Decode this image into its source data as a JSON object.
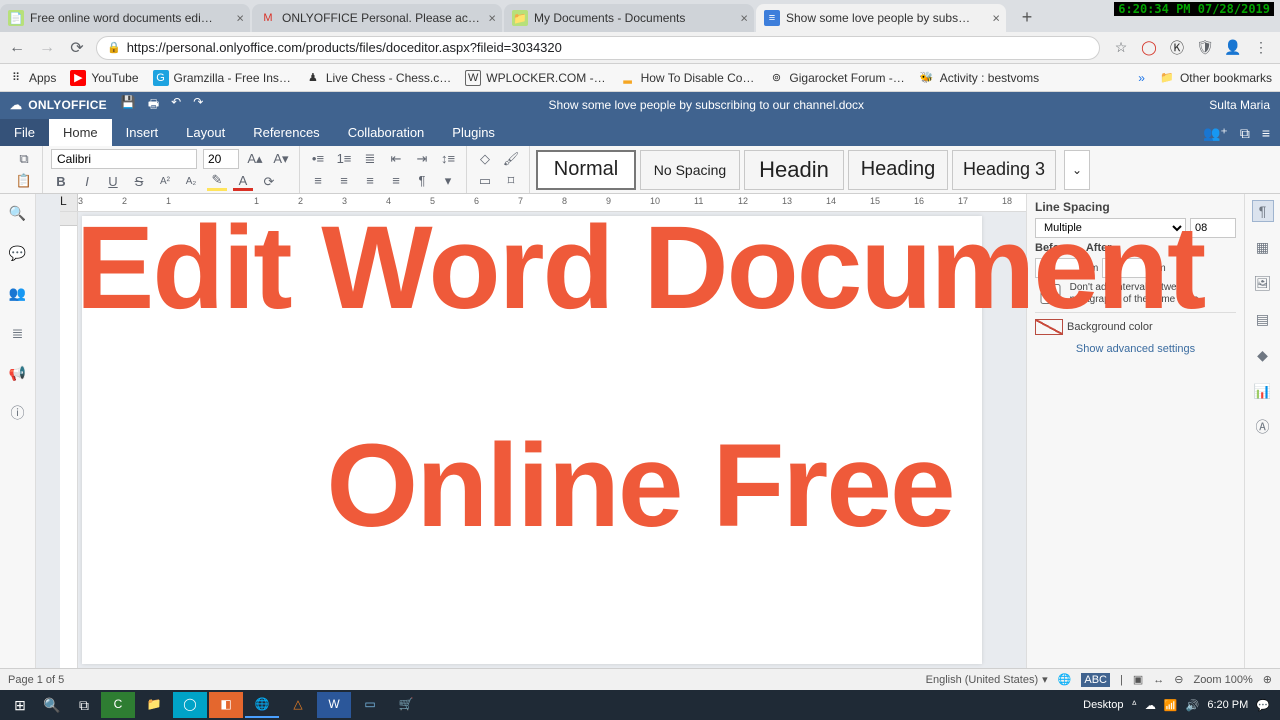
{
  "chrome": {
    "tabs": [
      {
        "title": "Free online word documents edi…"
      },
      {
        "title": "ONLYOFFICE Personal. Please ac…"
      },
      {
        "title": "My Documents - Documents"
      },
      {
        "title": "Show some love people by subs…"
      }
    ],
    "active_tab": 3,
    "url": "https://personal.onlyoffice.com/products/files/doceditor.aspx?fileid=3034320",
    "timestamp": "6:20:34 PM 07/28/2019",
    "bookmarks": [
      "Apps",
      "YouTube",
      "Gramzilla - Free Ins…",
      "Live Chess - Chess.c…",
      "WPLOCKER.COM -…",
      "How To Disable Co…",
      "Gigarocket Forum -…",
      "Activity : bestvoms"
    ],
    "other_bookmarks": "Other bookmarks"
  },
  "oo": {
    "brand": "ONLYOFFICE",
    "doc_title": "Show some love people by subscribing to our channel.docx",
    "user": "Sulta Maria",
    "menus": [
      "File",
      "Home",
      "Insert",
      "Layout",
      "References",
      "Collaboration",
      "Plugins"
    ],
    "active_menu": "Home",
    "font": "Calibri",
    "size": "20",
    "styles": [
      "Normal",
      "No Spacing",
      "Headin",
      "Heading",
      "Heading 3"
    ],
    "selected_style": 0,
    "ruler_numbers": [
      "3",
      "2",
      "1",
      "",
      "1",
      "2",
      "3",
      "4",
      "5",
      "6",
      "7",
      "8",
      "9",
      "10",
      "11",
      "12",
      "13",
      "14",
      "15",
      "16",
      "17",
      "18"
    ],
    "right_panel": {
      "title": "Line Spacing",
      "mode": "Multiple",
      "value": "08",
      "before_label": "Before",
      "after_label": "After",
      "before_val": "0",
      "after_val": "0",
      "unit": "cm",
      "chk": "Don't add interval between paragraphs of the same style",
      "bgcolor_label": "Background color",
      "adv": "Show advanced settings"
    },
    "status": {
      "page": "Page 1 of 5",
      "lang": "English (United States)",
      "zoom": "Zoom 100%"
    }
  },
  "overlay": {
    "line1": "Edit Word Document",
    "line2": "Online Free"
  },
  "win": {
    "desktop": "Desktop",
    "time": "6:20 PM"
  }
}
